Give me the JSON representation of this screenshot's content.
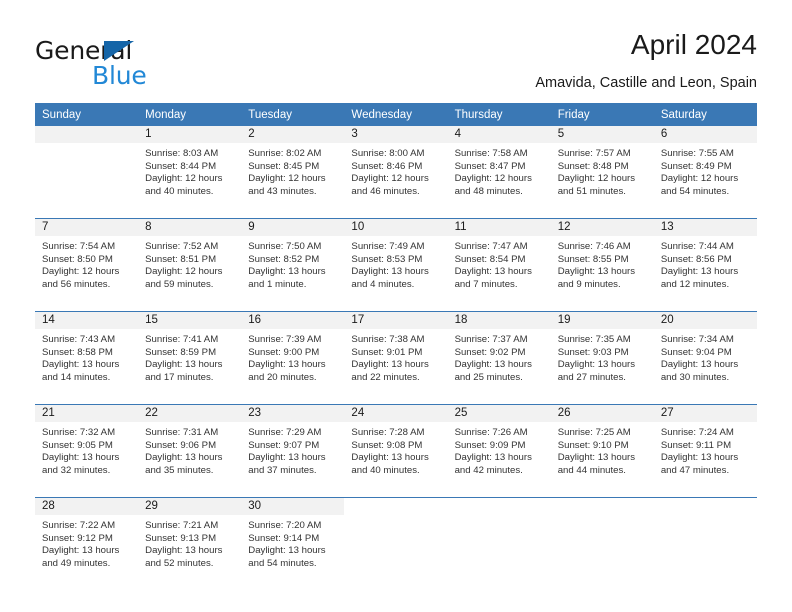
{
  "brand": {
    "name_part1": "General",
    "name_part2": "Blue",
    "accent_color": "#2288d6",
    "triangle_color": "#1565a8"
  },
  "header": {
    "title": "April 2024",
    "subtitle": "Amavida, Castille and Leon, Spain",
    "header_bg_color": "#3a78b5",
    "daynum_bg_color": "#f2f2f2"
  },
  "weekday_headers": [
    "Sunday",
    "Monday",
    "Tuesday",
    "Wednesday",
    "Thursday",
    "Friday",
    "Saturday"
  ],
  "labels": {
    "sunrise_prefix": "Sunrise:",
    "sunset_prefix": "Sunset:",
    "daylight_prefix": "Daylight:"
  },
  "weeks": [
    [
      {
        "day": "",
        "sunrise": "",
        "sunset": "",
        "daylight_line1": "",
        "daylight_line2": ""
      },
      {
        "day": "1",
        "sunrise": "Sunrise: 8:03 AM",
        "sunset": "Sunset: 8:44 PM",
        "daylight_line1": "Daylight: 12 hours",
        "daylight_line2": "and 40 minutes."
      },
      {
        "day": "2",
        "sunrise": "Sunrise: 8:02 AM",
        "sunset": "Sunset: 8:45 PM",
        "daylight_line1": "Daylight: 12 hours",
        "daylight_line2": "and 43 minutes."
      },
      {
        "day": "3",
        "sunrise": "Sunrise: 8:00 AM",
        "sunset": "Sunset: 8:46 PM",
        "daylight_line1": "Daylight: 12 hours",
        "daylight_line2": "and 46 minutes."
      },
      {
        "day": "4",
        "sunrise": "Sunrise: 7:58 AM",
        "sunset": "Sunset: 8:47 PM",
        "daylight_line1": "Daylight: 12 hours",
        "daylight_line2": "and 48 minutes."
      },
      {
        "day": "5",
        "sunrise": "Sunrise: 7:57 AM",
        "sunset": "Sunset: 8:48 PM",
        "daylight_line1": "Daylight: 12 hours",
        "daylight_line2": "and 51 minutes."
      },
      {
        "day": "6",
        "sunrise": "Sunrise: 7:55 AM",
        "sunset": "Sunset: 8:49 PM",
        "daylight_line1": "Daylight: 12 hours",
        "daylight_line2": "and 54 minutes."
      }
    ],
    [
      {
        "day": "7",
        "sunrise": "Sunrise: 7:54 AM",
        "sunset": "Sunset: 8:50 PM",
        "daylight_line1": "Daylight: 12 hours",
        "daylight_line2": "and 56 minutes."
      },
      {
        "day": "8",
        "sunrise": "Sunrise: 7:52 AM",
        "sunset": "Sunset: 8:51 PM",
        "daylight_line1": "Daylight: 12 hours",
        "daylight_line2": "and 59 minutes."
      },
      {
        "day": "9",
        "sunrise": "Sunrise: 7:50 AM",
        "sunset": "Sunset: 8:52 PM",
        "daylight_line1": "Daylight: 13 hours",
        "daylight_line2": "and 1 minute."
      },
      {
        "day": "10",
        "sunrise": "Sunrise: 7:49 AM",
        "sunset": "Sunset: 8:53 PM",
        "daylight_line1": "Daylight: 13 hours",
        "daylight_line2": "and 4 minutes."
      },
      {
        "day": "11",
        "sunrise": "Sunrise: 7:47 AM",
        "sunset": "Sunset: 8:54 PM",
        "daylight_line1": "Daylight: 13 hours",
        "daylight_line2": "and 7 minutes."
      },
      {
        "day": "12",
        "sunrise": "Sunrise: 7:46 AM",
        "sunset": "Sunset: 8:55 PM",
        "daylight_line1": "Daylight: 13 hours",
        "daylight_line2": "and 9 minutes."
      },
      {
        "day": "13",
        "sunrise": "Sunrise: 7:44 AM",
        "sunset": "Sunset: 8:56 PM",
        "daylight_line1": "Daylight: 13 hours",
        "daylight_line2": "and 12 minutes."
      }
    ],
    [
      {
        "day": "14",
        "sunrise": "Sunrise: 7:43 AM",
        "sunset": "Sunset: 8:58 PM",
        "daylight_line1": "Daylight: 13 hours",
        "daylight_line2": "and 14 minutes."
      },
      {
        "day": "15",
        "sunrise": "Sunrise: 7:41 AM",
        "sunset": "Sunset: 8:59 PM",
        "daylight_line1": "Daylight: 13 hours",
        "daylight_line2": "and 17 minutes."
      },
      {
        "day": "16",
        "sunrise": "Sunrise: 7:39 AM",
        "sunset": "Sunset: 9:00 PM",
        "daylight_line1": "Daylight: 13 hours",
        "daylight_line2": "and 20 minutes."
      },
      {
        "day": "17",
        "sunrise": "Sunrise: 7:38 AM",
        "sunset": "Sunset: 9:01 PM",
        "daylight_line1": "Daylight: 13 hours",
        "daylight_line2": "and 22 minutes."
      },
      {
        "day": "18",
        "sunrise": "Sunrise: 7:37 AM",
        "sunset": "Sunset: 9:02 PM",
        "daylight_line1": "Daylight: 13 hours",
        "daylight_line2": "and 25 minutes."
      },
      {
        "day": "19",
        "sunrise": "Sunrise: 7:35 AM",
        "sunset": "Sunset: 9:03 PM",
        "daylight_line1": "Daylight: 13 hours",
        "daylight_line2": "and 27 minutes."
      },
      {
        "day": "20",
        "sunrise": "Sunrise: 7:34 AM",
        "sunset": "Sunset: 9:04 PM",
        "daylight_line1": "Daylight: 13 hours",
        "daylight_line2": "and 30 minutes."
      }
    ],
    [
      {
        "day": "21",
        "sunrise": "Sunrise: 7:32 AM",
        "sunset": "Sunset: 9:05 PM",
        "daylight_line1": "Daylight: 13 hours",
        "daylight_line2": "and 32 minutes."
      },
      {
        "day": "22",
        "sunrise": "Sunrise: 7:31 AM",
        "sunset": "Sunset: 9:06 PM",
        "daylight_line1": "Daylight: 13 hours",
        "daylight_line2": "and 35 minutes."
      },
      {
        "day": "23",
        "sunrise": "Sunrise: 7:29 AM",
        "sunset": "Sunset: 9:07 PM",
        "daylight_line1": "Daylight: 13 hours",
        "daylight_line2": "and 37 minutes."
      },
      {
        "day": "24",
        "sunrise": "Sunrise: 7:28 AM",
        "sunset": "Sunset: 9:08 PM",
        "daylight_line1": "Daylight: 13 hours",
        "daylight_line2": "and 40 minutes."
      },
      {
        "day": "25",
        "sunrise": "Sunrise: 7:26 AM",
        "sunset": "Sunset: 9:09 PM",
        "daylight_line1": "Daylight: 13 hours",
        "daylight_line2": "and 42 minutes."
      },
      {
        "day": "26",
        "sunrise": "Sunrise: 7:25 AM",
        "sunset": "Sunset: 9:10 PM",
        "daylight_line1": "Daylight: 13 hours",
        "daylight_line2": "and 44 minutes."
      },
      {
        "day": "27",
        "sunrise": "Sunrise: 7:24 AM",
        "sunset": "Sunset: 9:11 PM",
        "daylight_line1": "Daylight: 13 hours",
        "daylight_line2": "and 47 minutes."
      }
    ],
    [
      {
        "day": "28",
        "sunrise": "Sunrise: 7:22 AM",
        "sunset": "Sunset: 9:12 PM",
        "daylight_line1": "Daylight: 13 hours",
        "daylight_line2": "and 49 minutes."
      },
      {
        "day": "29",
        "sunrise": "Sunrise: 7:21 AM",
        "sunset": "Sunset: 9:13 PM",
        "daylight_line1": "Daylight: 13 hours",
        "daylight_line2": "and 52 minutes."
      },
      {
        "day": "30",
        "sunrise": "Sunrise: 7:20 AM",
        "sunset": "Sunset: 9:14 PM",
        "daylight_line1": "Daylight: 13 hours",
        "daylight_line2": "and 54 minutes."
      },
      {
        "day": "",
        "sunrise": "",
        "sunset": "",
        "daylight_line1": "",
        "daylight_line2": ""
      },
      {
        "day": "",
        "sunrise": "",
        "sunset": "",
        "daylight_line1": "",
        "daylight_line2": ""
      },
      {
        "day": "",
        "sunrise": "",
        "sunset": "",
        "daylight_line1": "",
        "daylight_line2": ""
      },
      {
        "day": "",
        "sunrise": "",
        "sunset": "",
        "daylight_line1": "",
        "daylight_line2": ""
      }
    ]
  ]
}
